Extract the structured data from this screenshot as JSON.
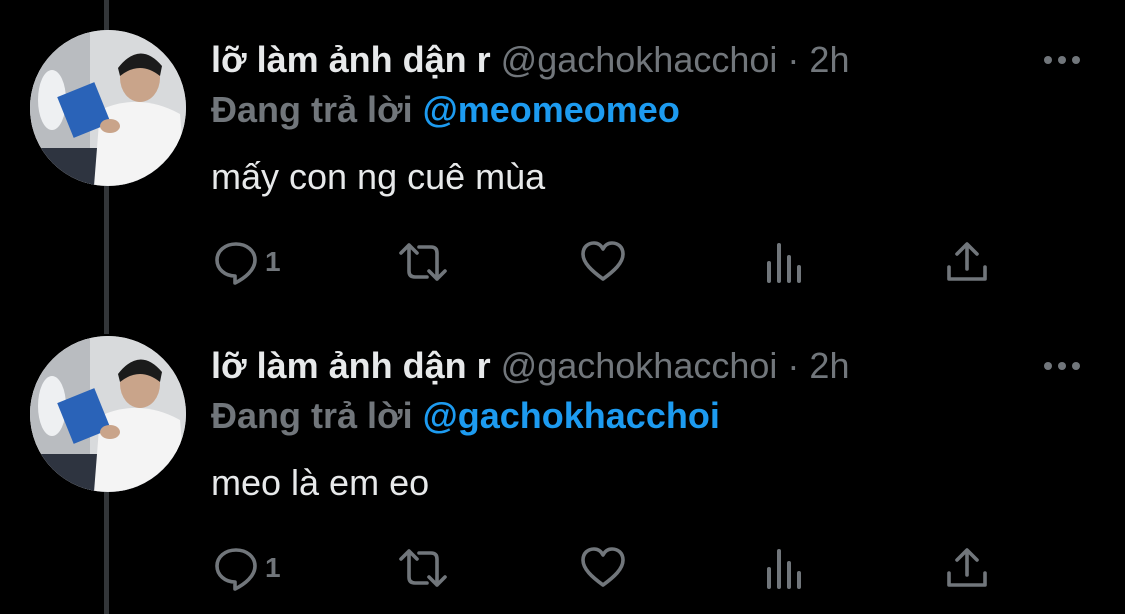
{
  "colors": {
    "background": "#000000",
    "primary_text": "#e7e9ea",
    "secondary_text": "#71767b",
    "mention_blue": "#1d9bf0",
    "thread_line": "#333639"
  },
  "tweets": [
    {
      "author_name": "lỡ làm ảnh dận r",
      "author_handle": "@gachokhacchoi",
      "separator": "·",
      "time": "2h",
      "more_icon": "more-horizontal-icon",
      "replying_label": "Đang trả lời",
      "replying_to": "@meomeomeo",
      "text": "mấy con ng cuê mùa",
      "actions": {
        "reply_icon": "reply-icon",
        "reply_count": "1",
        "retweet_icon": "retweet-icon",
        "like_icon": "heart-icon",
        "views_icon": "views-icon",
        "share_icon": "share-icon"
      }
    },
    {
      "author_name": "lỡ làm ảnh dận r",
      "author_handle": "@gachokhacchoi",
      "separator": "·",
      "time": "2h",
      "more_icon": "more-horizontal-icon",
      "replying_label": "Đang trả lời",
      "replying_to": "@gachokhacchoi",
      "text": "meo là em eo",
      "actions": {
        "reply_icon": "reply-icon",
        "reply_count": "1",
        "retweet_icon": "retweet-icon",
        "like_icon": "heart-icon",
        "views_icon": "views-icon",
        "share_icon": "share-icon"
      }
    }
  ]
}
